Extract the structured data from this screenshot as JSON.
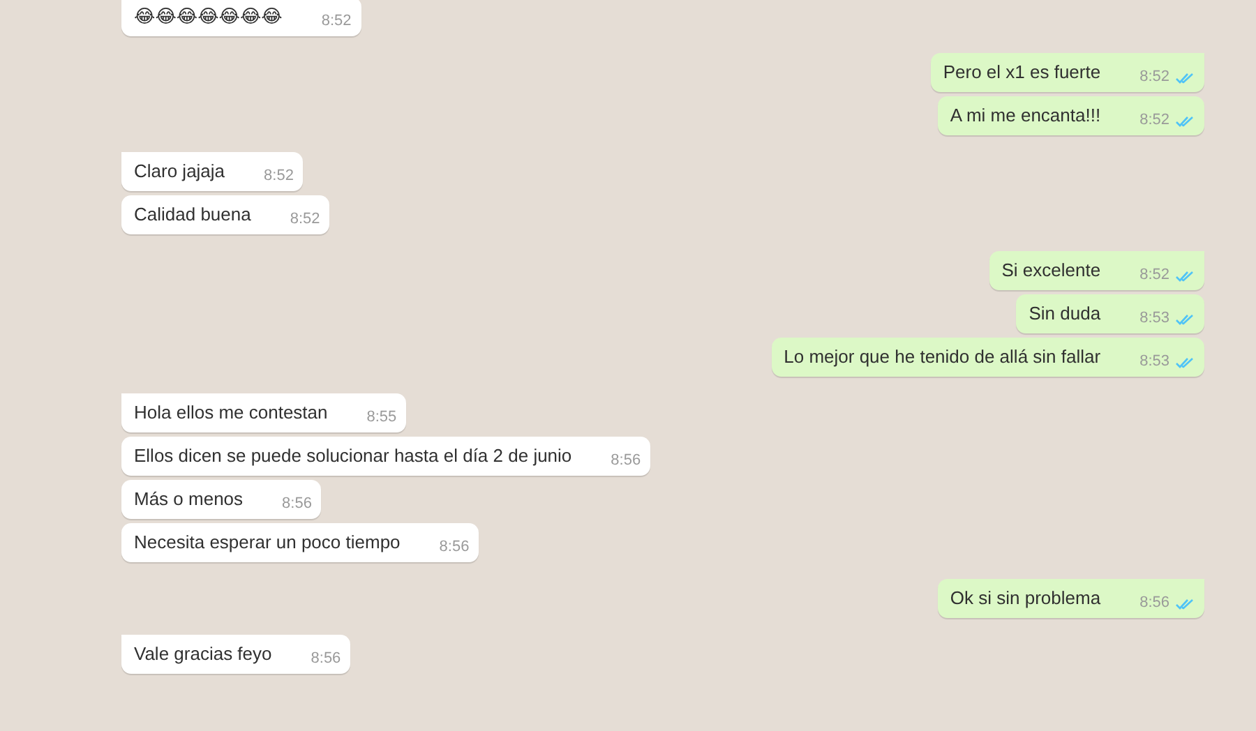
{
  "groups": [
    {
      "kind": "incoming",
      "messages": [
        {
          "text": "😂😂😂😂😂😂😂",
          "time": "8:52"
        }
      ]
    },
    {
      "kind": "outgoing",
      "messages": [
        {
          "text": "Pero el x1 es fuerte",
          "time": "8:52",
          "read": true
        },
        {
          "text": "A mi me encanta!!!",
          "time": "8:52",
          "read": true
        }
      ]
    },
    {
      "kind": "incoming",
      "messages": [
        {
          "text": "Claro jajaja",
          "time": "8:52"
        },
        {
          "text": "Calidad buena",
          "time": "8:52"
        }
      ]
    },
    {
      "kind": "outgoing",
      "messages": [
        {
          "text": "Si excelente",
          "time": "8:52",
          "read": true
        },
        {
          "text": "Sin duda",
          "time": "8:53",
          "read": true
        },
        {
          "text": "Lo mejor que he tenido de allá sin fallar",
          "time": "8:53",
          "read": true
        }
      ]
    },
    {
      "kind": "incoming",
      "messages": [
        {
          "text": "Hola ellos me contestan",
          "time": "8:55"
        },
        {
          "text": "Ellos dicen se puede solucionar hasta el día 2 de junio",
          "time": "8:56"
        },
        {
          "text": "Más o menos",
          "time": "8:56"
        },
        {
          "text": "Necesita esperar un poco tiempo",
          "time": "8:56"
        }
      ]
    },
    {
      "kind": "outgoing",
      "messages": [
        {
          "text": "Ok si sin problema",
          "time": "8:56",
          "read": true
        }
      ]
    },
    {
      "kind": "incoming",
      "messages": [
        {
          "text": "Vale gracias feyo",
          "time": "8:56"
        }
      ]
    }
  ]
}
